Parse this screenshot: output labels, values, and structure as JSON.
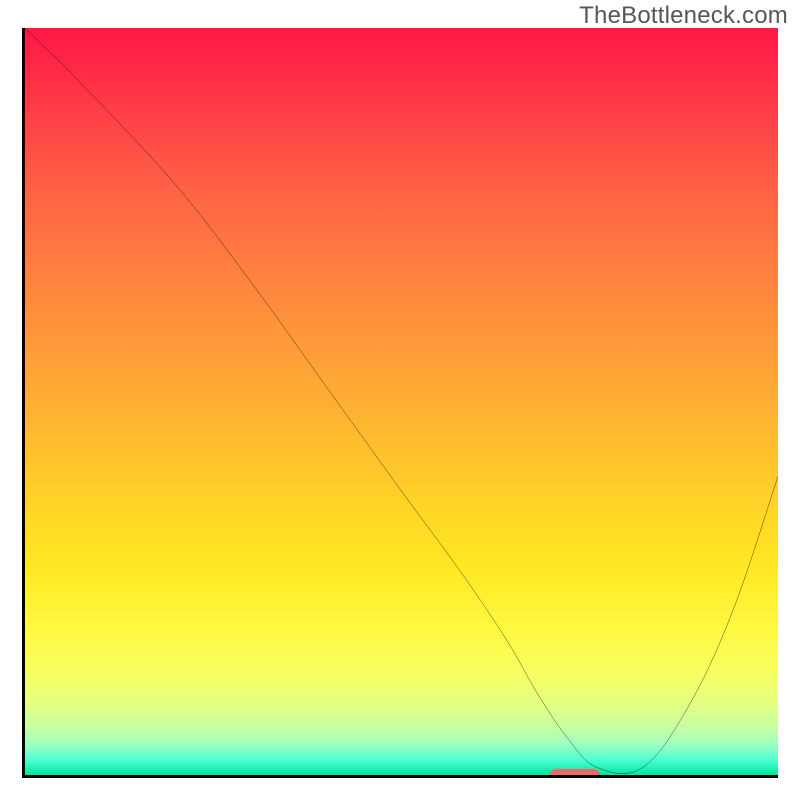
{
  "attribution": "TheBottleneck.com",
  "chart_data": {
    "type": "line",
    "title": "",
    "xlabel": "",
    "ylabel": "",
    "xlim": [
      0,
      100
    ],
    "ylim": [
      0,
      100
    ],
    "x": [
      0,
      8,
      20,
      30,
      40,
      50,
      58,
      64,
      68,
      72,
      76,
      82,
      88,
      94,
      100
    ],
    "values": [
      100,
      92,
      79,
      66,
      52,
      38,
      27,
      18,
      11,
      5,
      1,
      1,
      9,
      22,
      40
    ],
    "marker_x": 73
  }
}
